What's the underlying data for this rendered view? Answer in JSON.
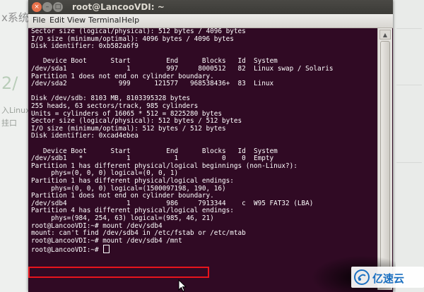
{
  "background": {
    "left_fragments": [
      "x系统",
      "2/",
      "入Linux",
      "挂口"
    ]
  },
  "window": {
    "title": "root@LancooVDI: ~",
    "buttons": {
      "close": "×",
      "minimize": "–",
      "maximize": "□"
    }
  },
  "menubar": {
    "items": [
      "File",
      "Edit",
      "View",
      "Terminal",
      "Help"
    ]
  },
  "terminal": {
    "lines": [
      "Sector size (logical/physical): 512 bytes / 4096 bytes",
      "I/O size (minimum/optimal): 4096 bytes / 4096 bytes",
      "Disk identifier: 0xb582a6f9",
      "",
      "   Device Boot      Start         End      Blocks   Id  System",
      "/dev/sda1               1         997     8000512   82  Linux swap / Solaris",
      "Partition 1 does not end on cylinder boundary.",
      "/dev/sda2             999      121577   968538436+  83  Linux",
      "",
      "Disk /dev/sdb: 8103 MB, 8103395328 bytes",
      "255 heads, 63 sectors/track, 985 cylinders",
      "Units = cylinders of 16065 * 512 = 8225280 bytes",
      "Sector size (logical/physical): 512 bytes / 512 bytes",
      "I/O size (minimum/optimal): 512 bytes / 512 bytes",
      "Disk identifier: 0xcad4ebea",
      "",
      "   Device Boot      Start         End      Blocks   Id  System",
      "/dev/sdb1   *           1           1           0    0  Empty",
      "Partition 1 has different physical/logical beginnings (non-Linux?):",
      "     phys=(0, 0, 0) logical=(0, 0, 1)",
      "Partition 1 has different physical/logical endings:",
      "     phys=(0, 0, 0) logical=(1500097198, 190, 16)",
      "Partition 1 does not end on cylinder boundary.",
      "/dev/sdb4               1         986     7913344    c  W95 FAT32 (LBA)",
      "Partition 4 has different physical/logical endings:",
      "     phys=(984, 254, 63) logical=(985, 46, 21)",
      "root@LancooVDI:~# mount /dev/sdb4",
      "mount: can't find /dev/sdb4 in /etc/fstab or /etc/mtab",
      "root@LancooVDI:~# mount /dev/sdb4 /mnt",
      "root@LancooVDI:~# "
    ]
  },
  "watermark": {
    "text": "亿速云"
  },
  "colors": {
    "terminal_bg": "#300a24",
    "terminal_fg": "#ffffff",
    "highlight": "#e8141c",
    "watermark": "#1a6fc0"
  }
}
